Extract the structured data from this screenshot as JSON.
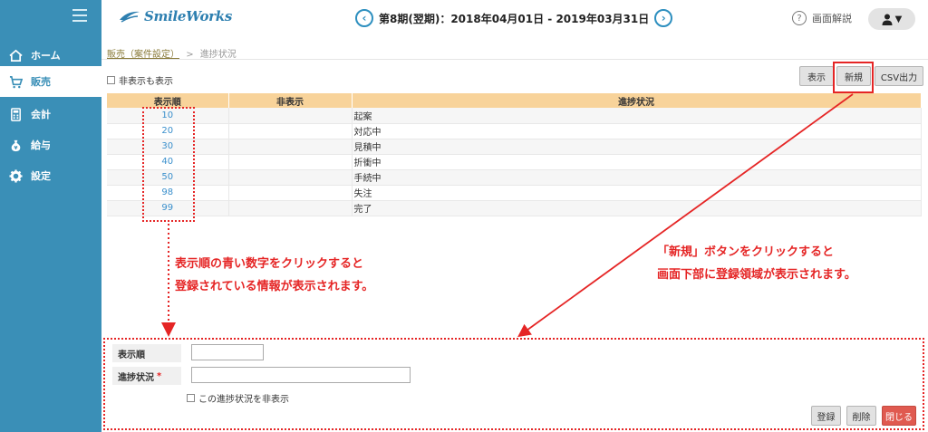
{
  "sidebar": {
    "items": [
      {
        "label": "ホーム",
        "icon": "home-icon"
      },
      {
        "label": "販売",
        "icon": "cart-icon"
      },
      {
        "label": "会計",
        "icon": "calculator-icon"
      },
      {
        "label": "給与",
        "icon": "money-bag-icon"
      },
      {
        "label": "設定",
        "icon": "gear-icon"
      }
    ],
    "active_index": 1
  },
  "header": {
    "logo_text": "SmileWorks",
    "period": "第8期(翌期)：2018年04月01日 - 2019年03月31日",
    "help_label": "画面解説"
  },
  "breadcrumb": {
    "link": "販売（案件設定）",
    "separator": ">",
    "current": "進捗状況"
  },
  "controls": {
    "show_hidden_label": "非表示も表示",
    "display_button": "表示",
    "new_button": "新規",
    "csv_button": "CSV出力"
  },
  "table": {
    "headers": [
      "表示順",
      "非表示",
      "進捗状況"
    ],
    "rows": [
      {
        "order": "10",
        "hidden": "",
        "status": "起案"
      },
      {
        "order": "20",
        "hidden": "",
        "status": "対応中"
      },
      {
        "order": "30",
        "hidden": "",
        "status": "見積中"
      },
      {
        "order": "40",
        "hidden": "",
        "status": "折衝中"
      },
      {
        "order": "50",
        "hidden": "",
        "status": "手続中"
      },
      {
        "order": "98",
        "hidden": "",
        "status": "失注"
      },
      {
        "order": "99",
        "hidden": "",
        "status": "完了"
      }
    ]
  },
  "annotations": {
    "left_line1": "表示順の青い数字をクリックすると",
    "left_line2": "登録されている情報が表示されます。",
    "right_line1": "「新規」ボタンをクリックすると",
    "right_line2": "画面下部に登録領域が表示されます。"
  },
  "form": {
    "order_label": "表示順",
    "status_label": "進捗状況",
    "required_mark": "*",
    "order_value": "",
    "status_value": "",
    "hide_checkbox_label": "この進捗状況を非表示",
    "register_button": "登録",
    "delete_button": "削除",
    "close_button": "閉じる"
  },
  "colors": {
    "sidebar": "#3a8fb7",
    "table_header": "#f8d39a",
    "annotation": "#e52525",
    "link_blue": "#3a8fcc",
    "close_button": "#e05a50"
  }
}
